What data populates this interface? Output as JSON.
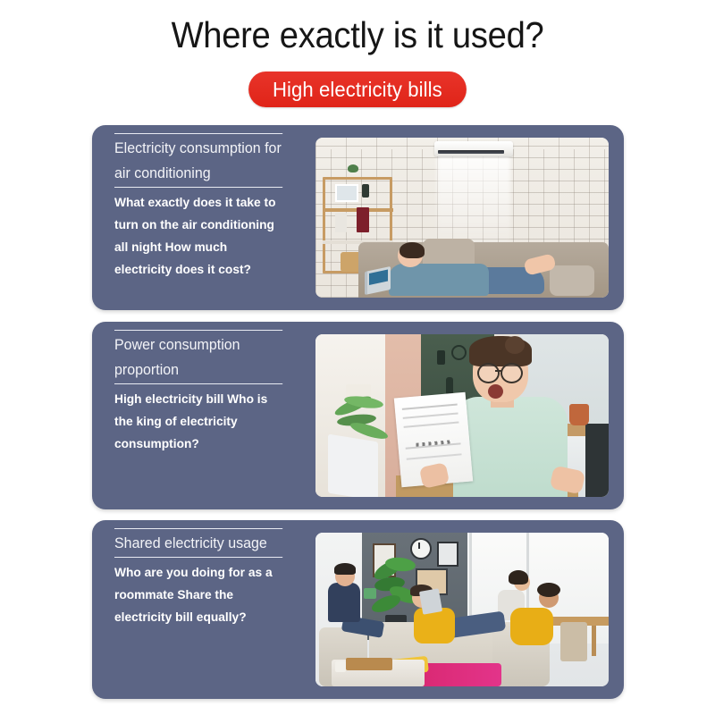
{
  "page": {
    "title": "Where exactly is it used?",
    "badge_label": "High electricity bills",
    "accent_red": "#e42d20",
    "card_bg": "#5c6585",
    "background": "#ffffff",
    "text_color": "#ffffff"
  },
  "cards": [
    {
      "heading": "Electricity consumption for air conditioning",
      "body": "What exactly does it take to turn on the air conditioning all night How much electricity does it cost?",
      "photo_alt": "Woman lying on a beige sofa using a laptop in a white brick living room with a wall-mounted air conditioner blowing cool air"
    },
    {
      "heading": "Power consumption proportion",
      "body": "High electricity bill Who is the king of electricity consumption?",
      "photo_alt": "Shocked young woman in a mint green shirt and glasses reading an electricity bill at a desk with a laptop and plant"
    },
    {
      "heading": "Shared electricity usage",
      "body": "Who are you doing for as a roommate Share the electricity bill equally?",
      "photo_alt": "Group of roommates relaxing in a shared living room with sofas, a monstera plant, wall art and a dining table"
    }
  ]
}
